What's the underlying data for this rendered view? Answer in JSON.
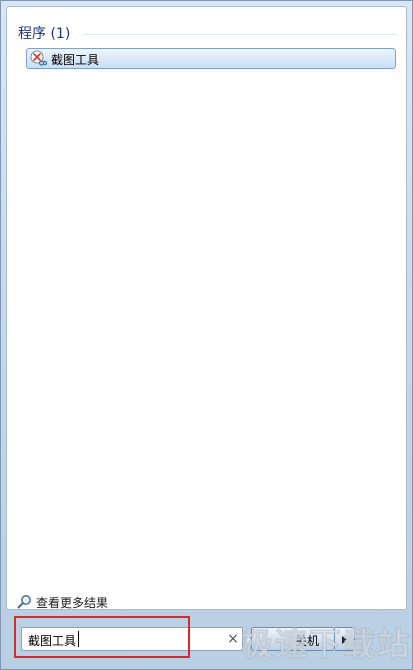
{
  "results": {
    "group_header": "程序 (1)",
    "items": [
      {
        "label": "截图工具",
        "icon": "scissors-icon"
      }
    ]
  },
  "see_more": {
    "label": "查看更多结果",
    "icon": "search-magnifier-icon"
  },
  "search": {
    "value": "截图工具",
    "clear_glyph": "×"
  },
  "shutdown": {
    "label": "关机"
  },
  "watermark": {
    "text": "极速下载站"
  },
  "colors": {
    "group_header": "#1e3287",
    "selection_border": "#7da2ce",
    "highlight": "#d22b2b"
  }
}
